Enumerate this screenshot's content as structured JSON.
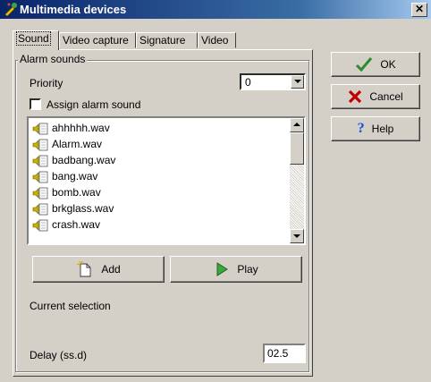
{
  "window": {
    "title": "Multimedia devices",
    "close_glyph": "✕"
  },
  "tabs": [
    {
      "label": "Sound",
      "active": true
    },
    {
      "label": "Video capture",
      "active": false
    },
    {
      "label": "Signature",
      "active": false
    },
    {
      "label": "Video",
      "active": false
    }
  ],
  "alarm_group": {
    "title": "Alarm sounds",
    "priority_label": "Priority",
    "priority_value": "0",
    "assign_label": "Assign alarm sound",
    "assign_checked": false,
    "files": [
      "ahhhhh.wav",
      "Alarm.wav",
      "badbang.wav",
      "bang.wav",
      "bomb.wav",
      "brkglass.wav",
      "crash.wav"
    ],
    "add_label": "Add",
    "play_label": "Play",
    "current_selection_label": "Current selection",
    "delay_label": "Delay (ss.d)",
    "delay_value": "02.5"
  },
  "side_buttons": {
    "ok_label": "OK",
    "cancel_label": "Cancel",
    "help_label": "Help"
  },
  "colors": {
    "ok_check": "#2e8b2e",
    "cancel_x": "#c00000",
    "help_q": "#1a4fd0"
  }
}
